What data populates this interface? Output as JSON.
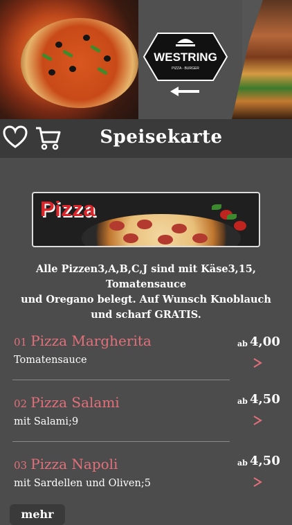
{
  "banner": {
    "logo_text": "WESTRING",
    "logo_subtitle": "PIZZA - BURGER"
  },
  "topbar": {
    "title": "Speisekarte"
  },
  "category": {
    "label": "Pizza"
  },
  "intro": {
    "line1": "Alle Pizzen3,A,B,C,J sind mit Käse3,15, Tomatensauce",
    "line2": "und Oregano belegt. Auf Wunsch Knoblauch",
    "line3": "und scharf GRATIS."
  },
  "items": [
    {
      "number": "01",
      "name": "Pizza Margherita",
      "description": "Tomatensauce",
      "ab": "ab",
      "price": "4,00"
    },
    {
      "number": "02",
      "name": "Pizza Salami",
      "description": "mit Salami;9",
      "ab": "ab",
      "price": "4,50"
    },
    {
      "number": "03",
      "name": "Pizza Napoli",
      "description": "mit Sardellen und Oliven;5",
      "ab": "ab",
      "price": "4,50"
    }
  ],
  "more_label": "mehr",
  "colors": {
    "accent": "#e3707a",
    "background": "#4c4c4c",
    "bar": "#3a3a3a"
  }
}
